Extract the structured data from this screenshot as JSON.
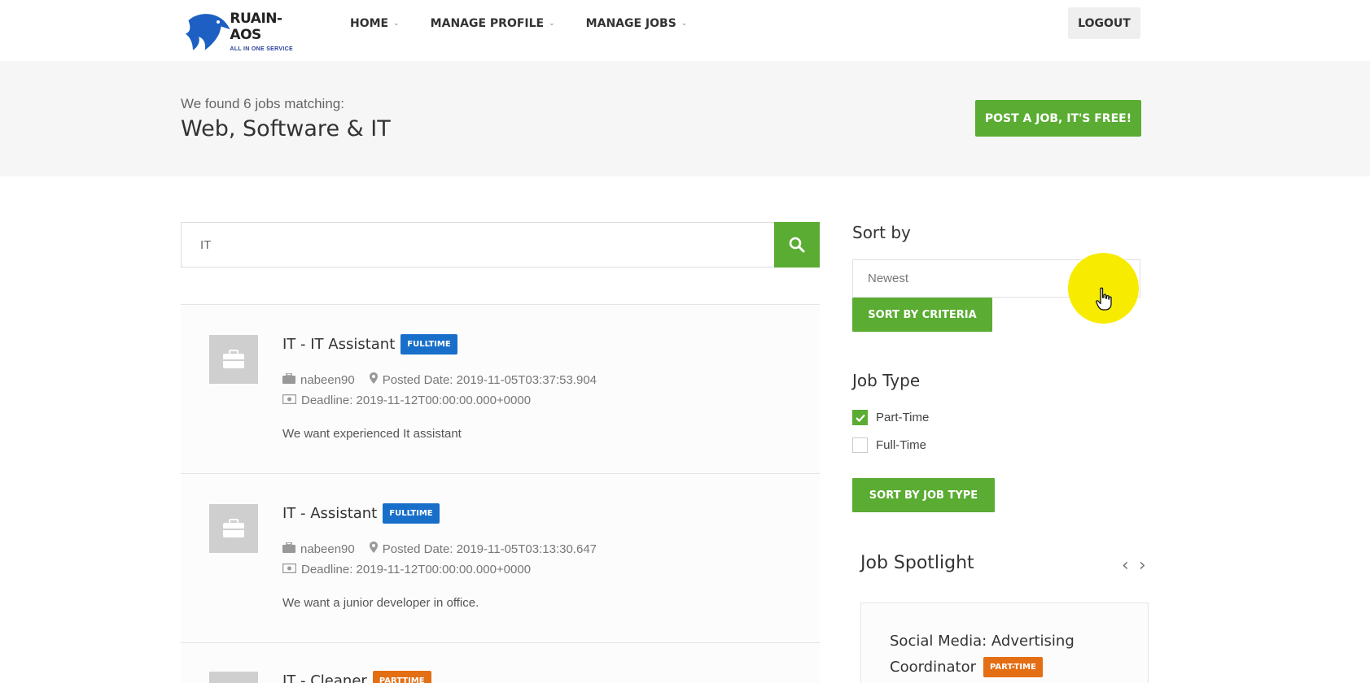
{
  "header": {
    "logo_title": "RUAIN-AOS",
    "logo_subtitle": "ALL IN ONE SERVICE",
    "nav": [
      {
        "label": "HOME"
      },
      {
        "label": "MANAGE PROFILE"
      },
      {
        "label": "MANAGE JOBS"
      }
    ],
    "logout_label": "LOGOUT"
  },
  "banner": {
    "found_text": "We found 6 jobs matching:",
    "category": "Web, Software & IT",
    "post_job_label": "POST A JOB, IT'S FREE!"
  },
  "search": {
    "value": "IT"
  },
  "jobs": [
    {
      "title": "IT - IT Assistant",
      "type": "FULLTIME",
      "company": "nabeen90",
      "posted": "Posted Date: 2019-11-05T03:37:53.904",
      "deadline": "Deadline: 2019-11-12T00:00:00.000+0000",
      "description": "We want experienced It assistant"
    },
    {
      "title": "IT - Assistant",
      "type": "FULLTIME",
      "company": "nabeen90",
      "posted": "Posted Date: 2019-11-05T03:13:30.647",
      "deadline": "Deadline: 2019-11-12T00:00:00.000+0000",
      "description": "We want a junior developer in office."
    },
    {
      "title": "IT - Cleaner",
      "type": "PARTTIME"
    }
  ],
  "sidebar": {
    "sort_title": "Sort by",
    "sort_selected": "Newest",
    "sort_button": "SORT BY CRITERIA",
    "job_type_title": "Job Type",
    "job_types": [
      {
        "label": "Part-Time",
        "checked": true
      },
      {
        "label": "Full-Time",
        "checked": false
      }
    ],
    "job_type_button": "SORT BY JOB TYPE",
    "spotlight_title": "Job Spotlight",
    "spotlight": {
      "title_line1": "Social Media: Advertising",
      "title_line2": "Coordinator",
      "type": "PART-TIME"
    }
  },
  "colors": {
    "green": "#5aac32",
    "blue_badge": "#186fc9",
    "orange_badge": "#e36e14",
    "cursor_highlight": "#f7ec00"
  }
}
